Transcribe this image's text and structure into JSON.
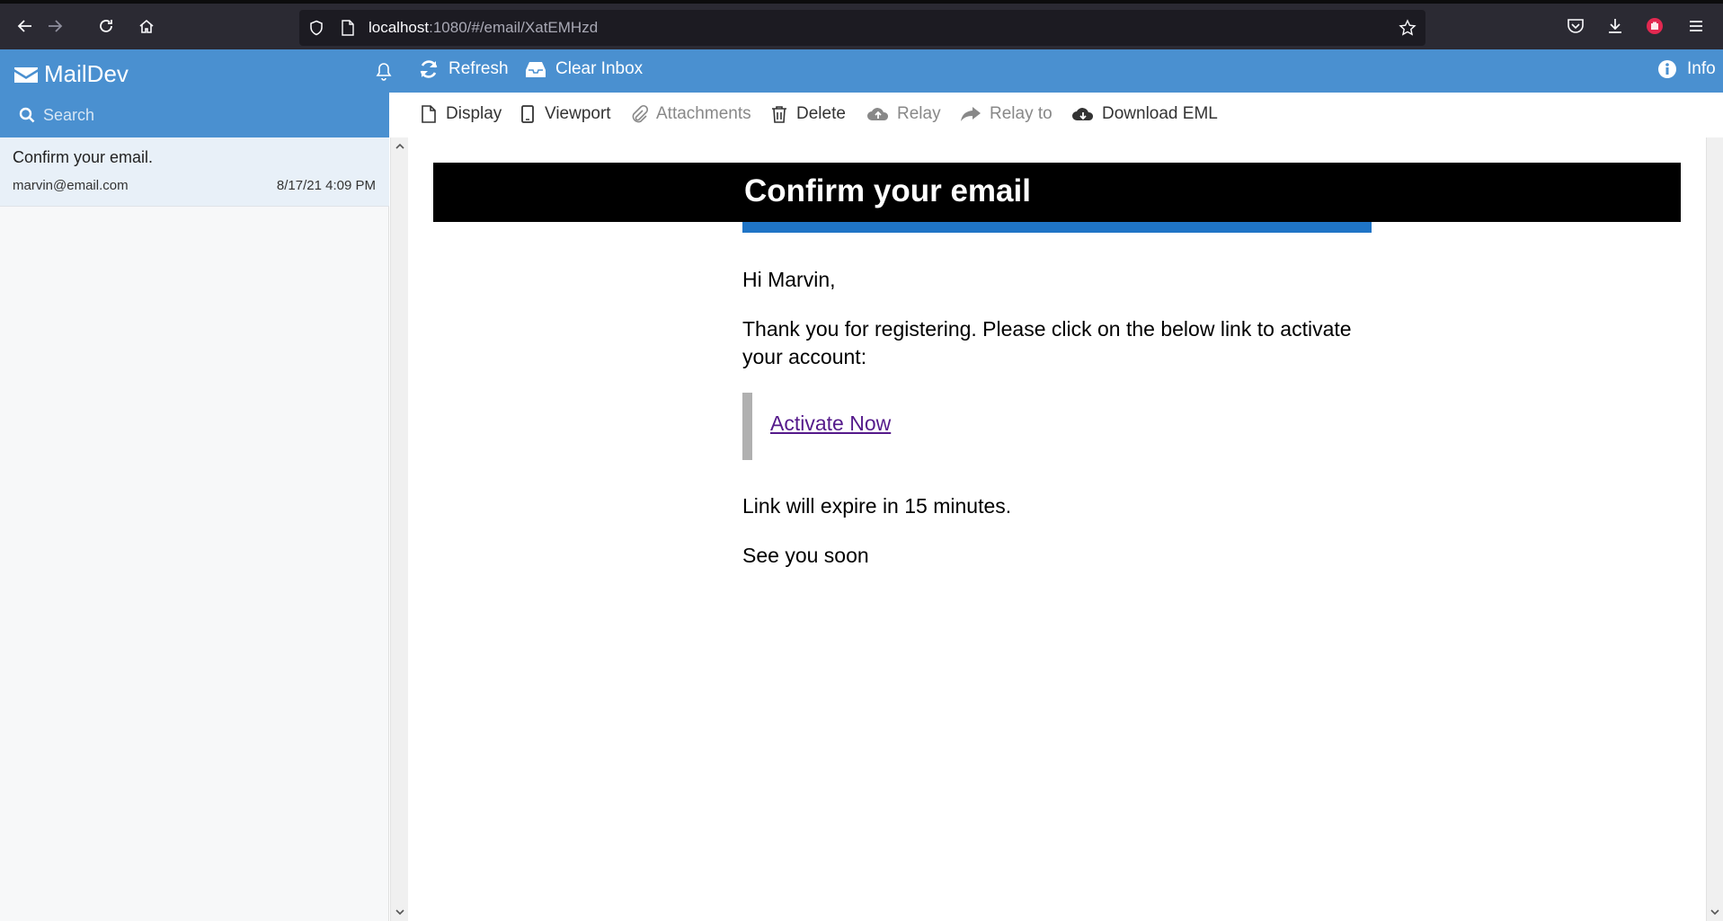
{
  "browser": {
    "url_host": "localhost",
    "url_rest": ":1080/#/email/XatEMHzd"
  },
  "app": {
    "brand": "MailDev",
    "refresh_label": "Refresh",
    "clear_label": "Clear Inbox",
    "info_label": "Info",
    "accent_color": "#4a90d0"
  },
  "search": {
    "placeholder": "Search"
  },
  "inbox": {
    "emails": [
      {
        "subject": "Confirm your email.",
        "from": "marvin@email.com",
        "date": "8/17/21 4:09 PM"
      }
    ]
  },
  "toolbar": {
    "display": "Display",
    "viewport": "Viewport",
    "attachments": "Attachments",
    "delete": "Delete",
    "relay": "Relay",
    "relay_to": "Relay to",
    "download": "Download EML"
  },
  "email": {
    "banner_title": "Confirm your email",
    "greeting": "Hi Marvin,",
    "paragraph": "Thank you for registering. Please click on the below link to activate your account:",
    "link_text": "Activate Now",
    "expiry": "Link will expire in 15 minutes.",
    "closing": "See you soon"
  }
}
